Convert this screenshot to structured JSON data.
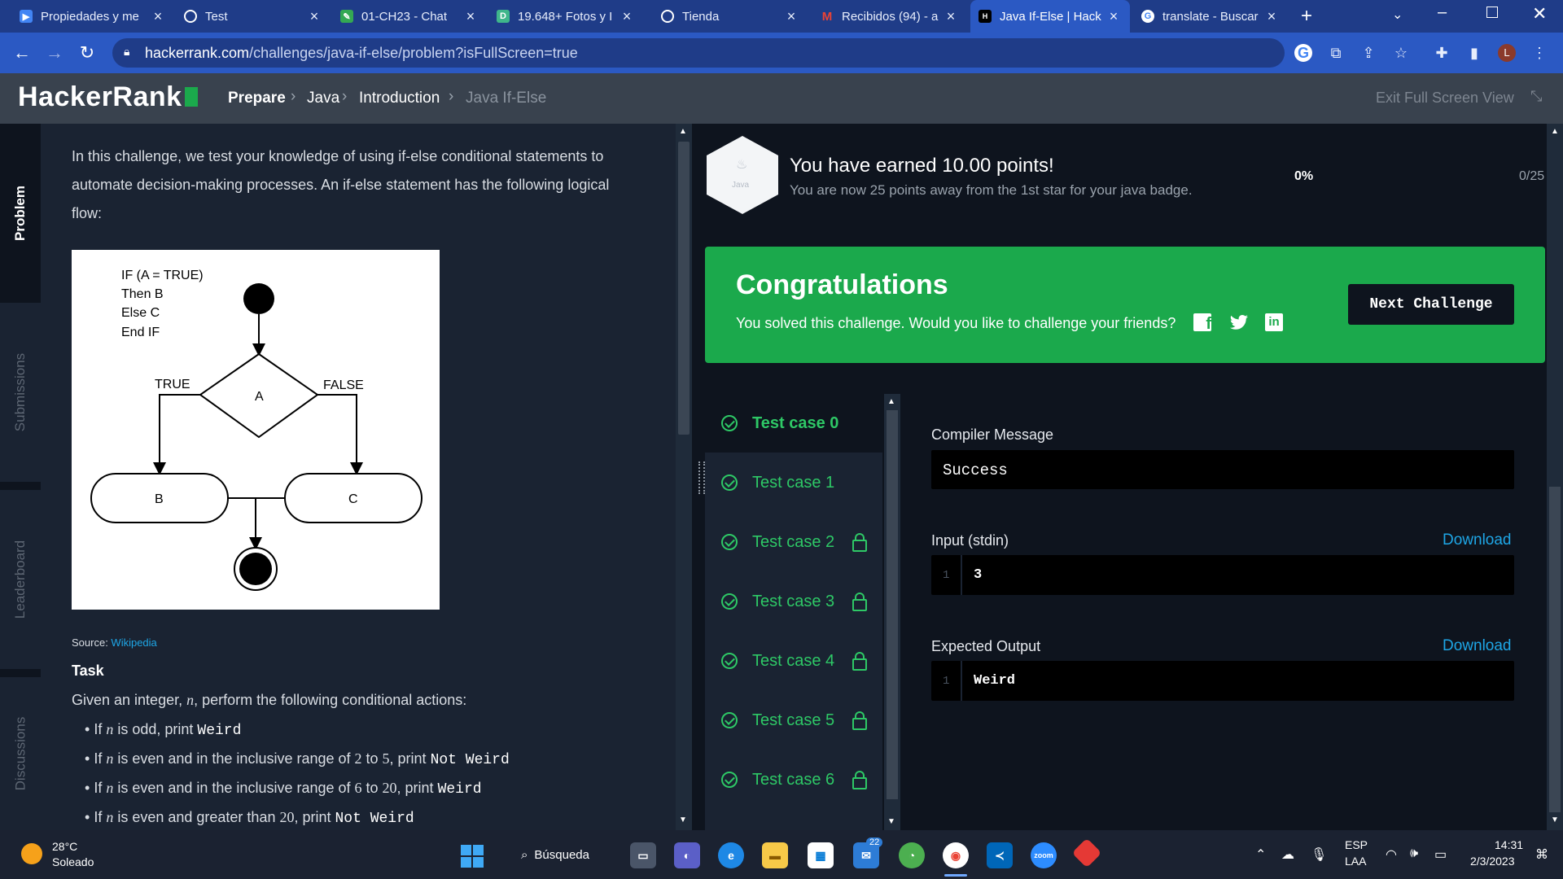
{
  "browser": {
    "tabs": [
      {
        "title": "Propiedades y me",
        "icon": "youtube-studio-icon",
        "color": "#4285f4"
      },
      {
        "title": "Test",
        "icon": "globe-icon",
        "color": "#ffffff"
      },
      {
        "title": "01-CH23 - Chat",
        "icon": "chat-icon",
        "color": "#34a853"
      },
      {
        "title": "19.648+ Fotos y I",
        "icon": "photos-icon",
        "color": "#3fb68b"
      },
      {
        "title": "Tienda",
        "icon": "globe-icon",
        "color": "#ffffff"
      },
      {
        "title": "Recibidos (94) - a",
        "icon": "gmail-icon",
        "color": "#ea4335"
      },
      {
        "title": "Java If-Else | Hack",
        "icon": "hackerrank-icon",
        "color": "#000000"
      },
      {
        "title": "translate - Buscar",
        "icon": "google-icon",
        "color": "#ffffff"
      }
    ],
    "url_host": "hackerrank.com",
    "url_path": "/challenges/java-if-else/problem?isFullScreen=true",
    "profile_initial": "L"
  },
  "header": {
    "logo": "HackerRank",
    "breadcrumbs": [
      "Prepare",
      "Java",
      "Introduction",
      "Java If-Else"
    ],
    "exit_fullscreen": "Exit Full Screen View"
  },
  "leftnav": [
    "Problem",
    "Submissions",
    "Leaderboard",
    "Discussions"
  ],
  "problem": {
    "intro_lines": [
      "In this challenge, we test your knowledge of using if-else conditional statements to",
      "automate decision-making processes. An if-else statement has the following logical",
      "flow:"
    ],
    "flow": {
      "pseudo": [
        "IF (A = TRUE)",
        "Then B",
        "Else C",
        "End IF"
      ],
      "true_label": "TRUE",
      "false_label": "FALSE",
      "decision": "A",
      "node_b": "B",
      "node_c": "C"
    },
    "source_label": "Source: ",
    "source_link": "Wikipedia",
    "task_heading": "Task",
    "task_text_pre": "Given an integer, ",
    "task_var": "n",
    "task_text_post": ", perform the following conditional actions:",
    "bullets": [
      {
        "pre": "If ",
        "var": "n",
        "mid": " is odd, print ",
        "code": "Weird"
      },
      {
        "pre": "If ",
        "var": "n",
        "mid": " is even and in the inclusive range of ",
        "a": "2",
        "to": " to ",
        "b": "5",
        "end": ", print ",
        "code": "Not Weird"
      },
      {
        "pre": "If ",
        "var": "n",
        "mid": " is even and in the inclusive range of ",
        "a": "6",
        "to": " to ",
        "b": "20",
        "end": ", print ",
        "code": "Weird"
      },
      {
        "pre": "If ",
        "var": "n",
        "mid": " is even and greater than ",
        "a": "20",
        "end": ", print ",
        "code": "Not Weird"
      }
    ]
  },
  "badge": {
    "icon_label": "Java",
    "title": "You have earned 10.00 points!",
    "subtitle": "You are now 25 points away from the 1st star for your java badge.",
    "percent": "0%",
    "progress": "0/25"
  },
  "congrats": {
    "title": "Congratulations",
    "text": "You solved this challenge. Would you like to challenge your friends?",
    "next_button": "Next Challenge"
  },
  "testcases": [
    {
      "label": "Test case 0",
      "locked": false,
      "active": true
    },
    {
      "label": "Test case 1",
      "locked": false,
      "active": false
    },
    {
      "label": "Test case 2",
      "locked": true,
      "active": false
    },
    {
      "label": "Test case 3",
      "locked": true,
      "active": false
    },
    {
      "label": "Test case 4",
      "locked": true,
      "active": false
    },
    {
      "label": "Test case 5",
      "locked": true,
      "active": false
    },
    {
      "label": "Test case 6",
      "locked": true,
      "active": false
    }
  ],
  "results": {
    "compiler_label": "Compiler Message",
    "compiler_value": "Success",
    "input_label": "Input (stdin)",
    "input_line": "1",
    "input_value": "3",
    "expected_label": "Expected Output",
    "expected_line": "1",
    "expected_value": "Weird",
    "download": "Download"
  },
  "taskbar": {
    "temp": "28°C",
    "weather": "Soleado",
    "search": "Búsqueda",
    "mail_badge": "22",
    "lang": "ESP",
    "lang2": "LAA",
    "time": "14:31",
    "date": "2/3/2023"
  },
  "colors": {
    "accent_green": "#1ba94c",
    "pass_green": "#2ec866",
    "link_blue": "#1ea6e6",
    "header_bg": "#39424e"
  }
}
